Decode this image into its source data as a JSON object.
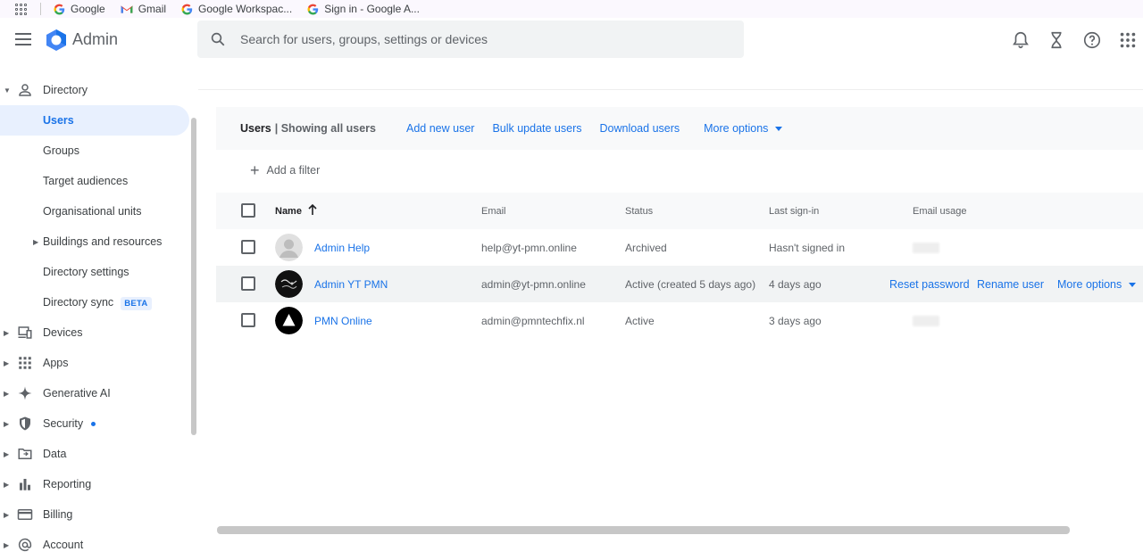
{
  "bookmarks": [
    "Google",
    "Gmail",
    "Google Workspac...",
    "Sign in - Google A..."
  ],
  "header": {
    "app_title": "Admin",
    "search_placeholder": "Search for users, groups, settings or devices"
  },
  "sidebar": {
    "directory": {
      "label": "Directory",
      "items": [
        "Users",
        "Groups",
        "Target audiences",
        "Organisational units",
        "Buildings and resources",
        "Directory settings",
        "Directory sync"
      ],
      "beta": "BETA"
    },
    "sections": [
      "Devices",
      "Apps",
      "Generative AI",
      "Security",
      "Data",
      "Reporting",
      "Billing",
      "Account"
    ]
  },
  "toolbar": {
    "title": "Users",
    "subtitle": "| Showing all users",
    "actions": [
      "Add new user",
      "Bulk update users",
      "Download users",
      "More options"
    ]
  },
  "filter": {
    "label": "Add a filter"
  },
  "table": {
    "columns": [
      "Name",
      "Email",
      "Status",
      "Last sign-in",
      "Email usage"
    ],
    "rows": [
      {
        "name": "Admin Help",
        "email": "help@yt-pmn.online",
        "status": "Archived",
        "last_sign_in": "Hasn't signed in"
      },
      {
        "name": "Admin YT PMN",
        "email": "admin@yt-pmn.online",
        "status": "Active (created 5 days ago)",
        "last_sign_in": "4 days ago"
      },
      {
        "name": "PMN Online",
        "email": "admin@pmntechfix.nl",
        "status": "Active",
        "last_sign_in": "3 days ago"
      }
    ],
    "row_actions": [
      "Reset password",
      "Rename user",
      "More options"
    ]
  },
  "colors": {
    "accent": "#1a73e8",
    "active_bg": "#e8f0fe"
  }
}
